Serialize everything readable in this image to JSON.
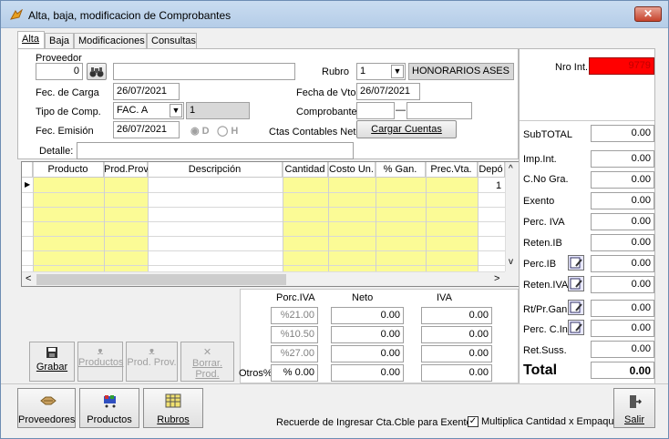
{
  "window": {
    "title": "Alta, baja, modificacion de Comprobantes",
    "close": "✕"
  },
  "tabs": [
    {
      "label": "Alta"
    },
    {
      "label": "Baja"
    },
    {
      "label": "Modificaciones"
    },
    {
      "label": "Consultas"
    }
  ],
  "form": {
    "proveedor_label": "Proveedor",
    "proveedor_code": "0",
    "proveedor_name": "",
    "rubro_label": "Rubro",
    "rubro_value": "1",
    "rubro_desc": "HONORARIOS ASES",
    "nro_int_label": "Nro Int.",
    "nro_int_value": "9779",
    "fec_carga_label": "Fec. de Carga",
    "fec_carga_value": "26/07/2021",
    "fecha_vto_label": "Fecha de Vto",
    "fecha_vto_value": "26/07/2021",
    "tipo_comp_label": "Tipo de Comp.",
    "tipo_comp_value": "FAC. A",
    "tipo_comp_code": "1",
    "comprobante_label": "Comprobante",
    "comprobante_a": "",
    "comprobante_b": "",
    "fec_emision_label": "Fec. Emisión",
    "fec_emision_value": "26/07/2021",
    "radio_d": "D",
    "radio_h": "H",
    "ctas_label": "Ctas Contables Neto",
    "cargar_cuentas": "Cargar Cuentas",
    "detalle_label": "Detalle:",
    "detalle_value": ""
  },
  "grid": {
    "columns": [
      "Producto",
      "Prod.Prov.",
      "Descripción",
      "Cantidad",
      "Costo Un.",
      "% Gan.",
      "Prec.Vta.",
      "Depó"
    ],
    "first_row_deposito": "1"
  },
  "iva": {
    "headers": [
      "Porc.IVA",
      "Neto",
      "IVA"
    ],
    "otros_label": "Otros%",
    "rows": [
      {
        "porc": "%21.00",
        "neto": "0.00",
        "iva": "0.00"
      },
      {
        "porc": "%10.50",
        "neto": "0.00",
        "iva": "0.00"
      },
      {
        "porc": "%27.00",
        "neto": "0.00",
        "iva": "0.00"
      },
      {
        "porc": "% 0.00",
        "neto": "0.00",
        "iva": "0.00"
      }
    ]
  },
  "totals": {
    "subtotal_label": "SubTOTAL",
    "subtotal": "0.00",
    "items": [
      {
        "label": "Imp.Int.",
        "value": "0.00"
      },
      {
        "label": "C.No Gra.",
        "value": "0.00"
      },
      {
        "label": "Exento",
        "value": "0.00"
      },
      {
        "label": "Perc. IVA",
        "value": "0.00"
      },
      {
        "label": "Reten.IB",
        "value": "0.00"
      },
      {
        "label": "Perc.IB",
        "value": "0.00"
      },
      {
        "label": "Reten.IVA",
        "value": "0.00"
      },
      {
        "label": "Rt/Pr.Gan",
        "value": "0.00"
      },
      {
        "label": "Perc. C.In:",
        "value": "0.00"
      },
      {
        "label": "Ret.Suss.",
        "value": "0.00"
      }
    ],
    "total_label": "Total",
    "total": "0.00"
  },
  "actions": {
    "grabar": "Grabar",
    "productos": "Productos",
    "prod_prov": "Prod. Prov.",
    "borrar_prod": "Borrar. Prod."
  },
  "bottom": {
    "proveedores": "Proveedores",
    "productos": "Productos",
    "rubros": "Rubros",
    "note": "Recuerde de Ingresar Cta.Cble para Exento",
    "multiplica": "Multiplica Cantidad x Empaque",
    "salir": "Salir"
  },
  "colors": {
    "nro_int_bg": "#ff0000",
    "grid_yellow": "#fbfb96"
  }
}
